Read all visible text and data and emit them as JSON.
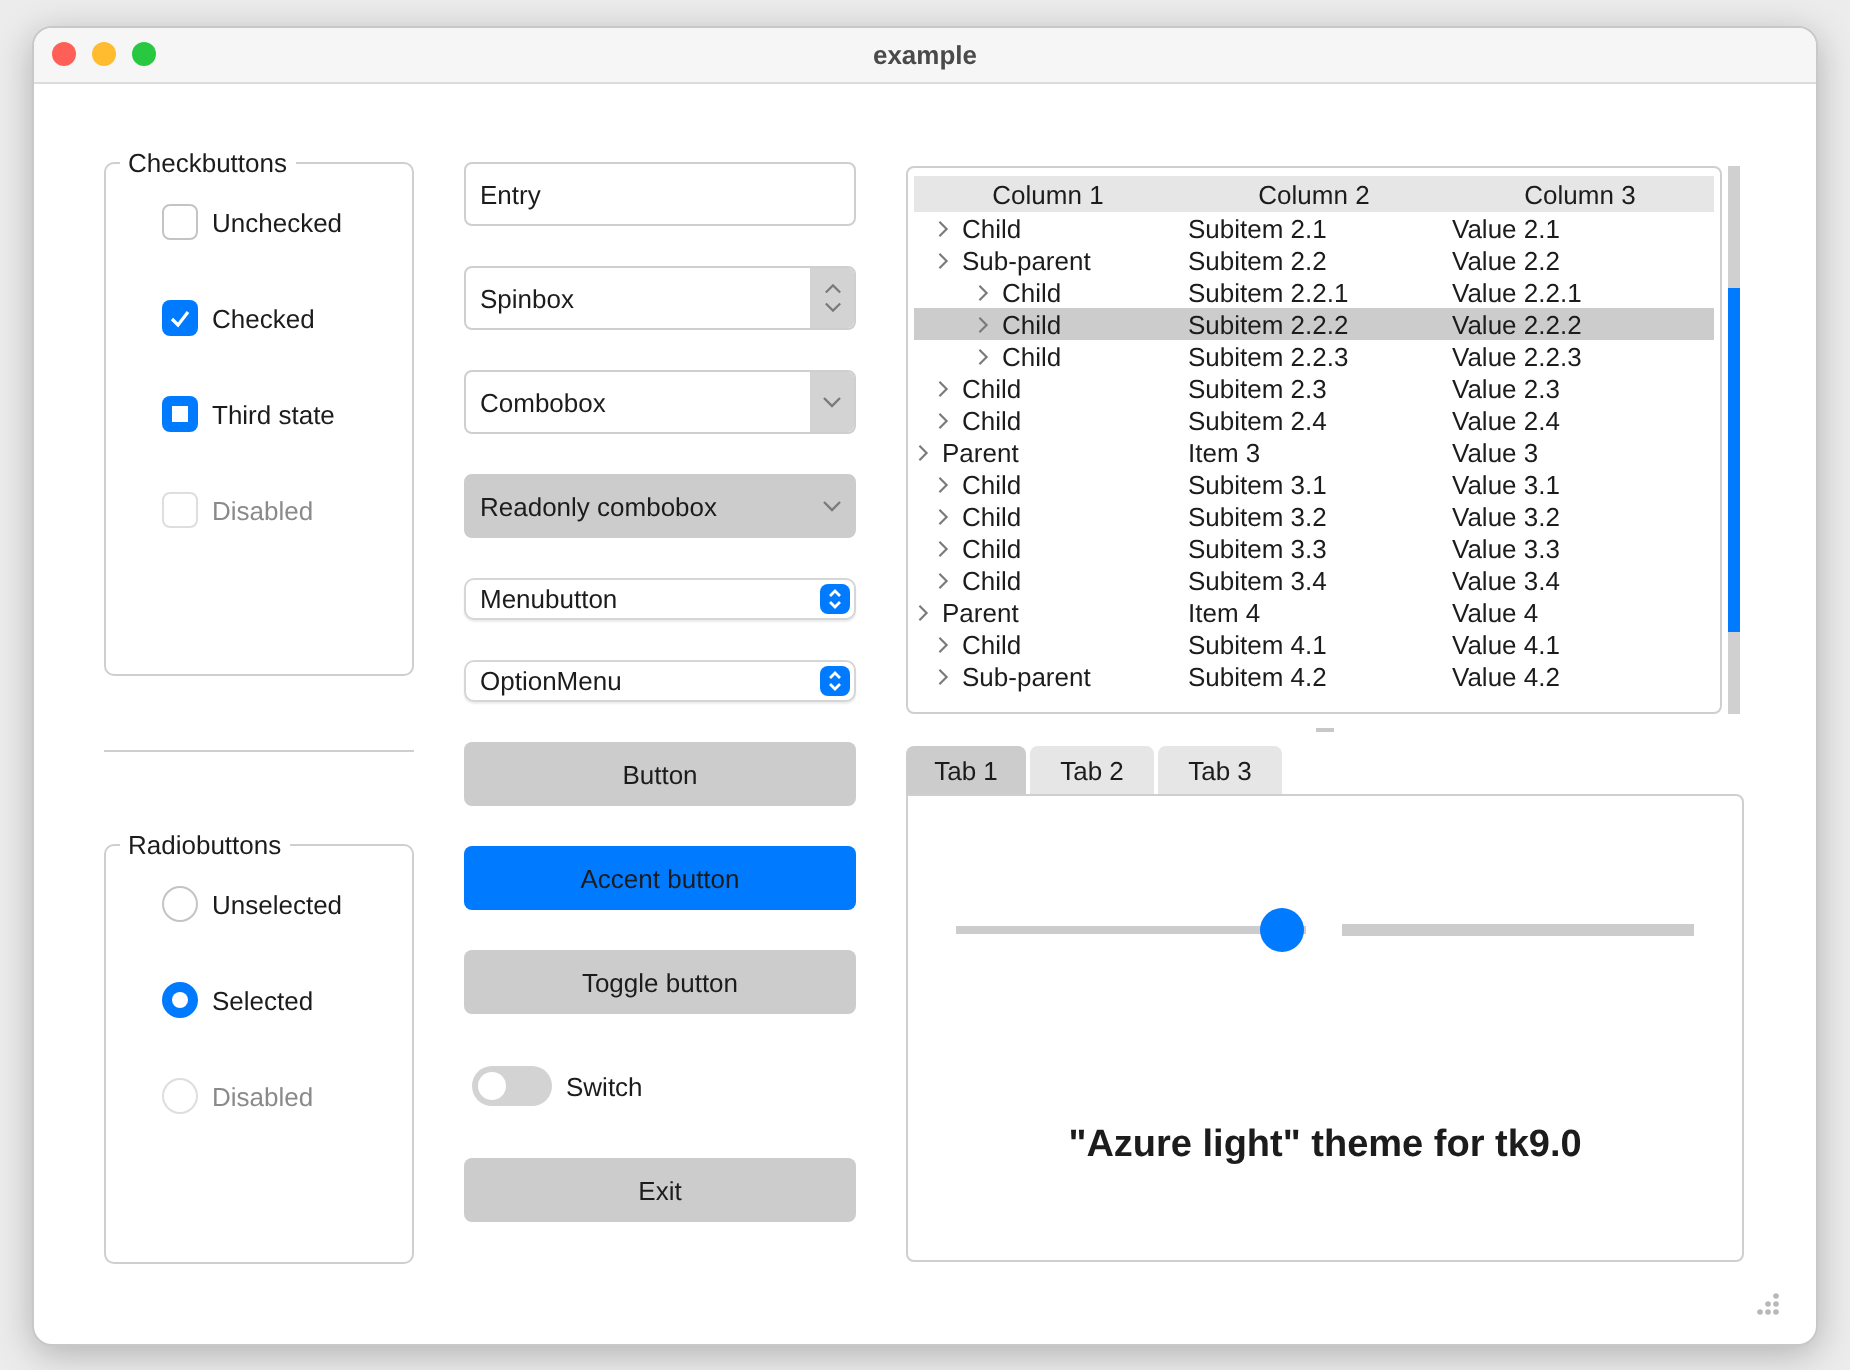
{
  "window": {
    "title": "example"
  },
  "checkbuttons": {
    "title": "Checkbuttons",
    "items": [
      {
        "label": "Unchecked",
        "checked": false,
        "disabled": false
      },
      {
        "label": "Checked",
        "checked": true,
        "disabled": false
      },
      {
        "label": "Third state",
        "checked": true,
        "alternate": true,
        "disabled": false
      },
      {
        "label": "Disabled",
        "checked": false,
        "disabled": true
      }
    ]
  },
  "radiobuttons": {
    "title": "Radiobuttons",
    "items": [
      {
        "label": "Unselected",
        "selected": false,
        "disabled": false
      },
      {
        "label": "Selected",
        "selected": true,
        "disabled": false
      },
      {
        "label": "Disabled",
        "selected": false,
        "disabled": true
      }
    ]
  },
  "widgets": [
    {
      "kind": "entry",
      "value": "Entry"
    },
    {
      "kind": "spinbox",
      "value": "Spinbox"
    },
    {
      "kind": "combobox",
      "value": "Combobox"
    },
    {
      "kind": "readonly",
      "value": "Readonly combobox"
    },
    {
      "kind": "menubutton",
      "label": "Menubutton"
    },
    {
      "kind": "menubutton",
      "label": "OptionMenu"
    },
    {
      "kind": "button",
      "label": "Button"
    },
    {
      "kind": "accent",
      "label": "Accent button"
    },
    {
      "kind": "button",
      "label": "Toggle button"
    },
    {
      "kind": "switch",
      "label": "Switch",
      "on": false
    },
    {
      "kind": "button",
      "label": "Exit"
    }
  ],
  "tree": {
    "columns": [
      "Column 1",
      "Column 2",
      "Column 3"
    ],
    "rows": [
      {
        "children": [
          {
            "cells": [
              "Child",
              "Subitem 2.1",
              "Value 2.1"
            ],
            "selected": false
          },
          {
            "cells": [
              "Sub-parent",
              "Subitem 2.2",
              "Value 2.2"
            ],
            "selected": false,
            "children": [
              {
                "cells": [
                  "Child",
                  "Subitem 2.2.1",
                  "Value 2.2.1"
                ],
                "selected": false
              },
              {
                "cells": [
                  "Child",
                  "Subitem 2.2.2",
                  "Value 2.2.2"
                ],
                "selected": true
              },
              {
                "cells": [
                  "Child",
                  "Subitem 2.2.3",
                  "Value 2.2.3"
                ],
                "selected": false
              }
            ]
          },
          {
            "cells": [
              "Child",
              "Subitem 2.3",
              "Value 2.3"
            ],
            "selected": false
          },
          {
            "cells": [
              "Child",
              "Subitem 2.4",
              "Value 2.4"
            ],
            "selected": false
          }
        ]
      },
      {
        "cells": [
          "Parent",
          "Item 3",
          "Value 3"
        ],
        "selected": false,
        "children": [
          {
            "cells": [
              "Child",
              "Subitem 3.1",
              "Value 3.1"
            ],
            "selected": false
          },
          {
            "cells": [
              "Child",
              "Subitem 3.2",
              "Value 3.2"
            ],
            "selected": false
          },
          {
            "cells": [
              "Child",
              "Subitem 3.3",
              "Value 3.3"
            ],
            "selected": false
          },
          {
            "cells": [
              "Child",
              "Subitem 3.4",
              "Value 3.4"
            ],
            "selected": false
          }
        ]
      },
      {
        "cells": [
          "Parent",
          "Item 4",
          "Value 4"
        ],
        "selected": false,
        "children": [
          {
            "cells": [
              "Child",
              "Subitem 4.1",
              "Value 4.1"
            ],
            "selected": false
          },
          {
            "cells": [
              "Sub-parent",
              "Subitem 4.2",
              "Value 4.2"
            ],
            "selected": false
          }
        ]
      }
    ]
  },
  "tabs": [
    {
      "label": "Tab 1",
      "selected": true
    },
    {
      "label": "Tab 2",
      "selected": false
    },
    {
      "label": "Tab 3",
      "selected": false
    }
  ],
  "tab_panel": {
    "slider": {
      "level": 0.93
    },
    "progress": {
      "level": 0
    },
    "caption": "\"Azure light\" theme for tk9.0"
  }
}
